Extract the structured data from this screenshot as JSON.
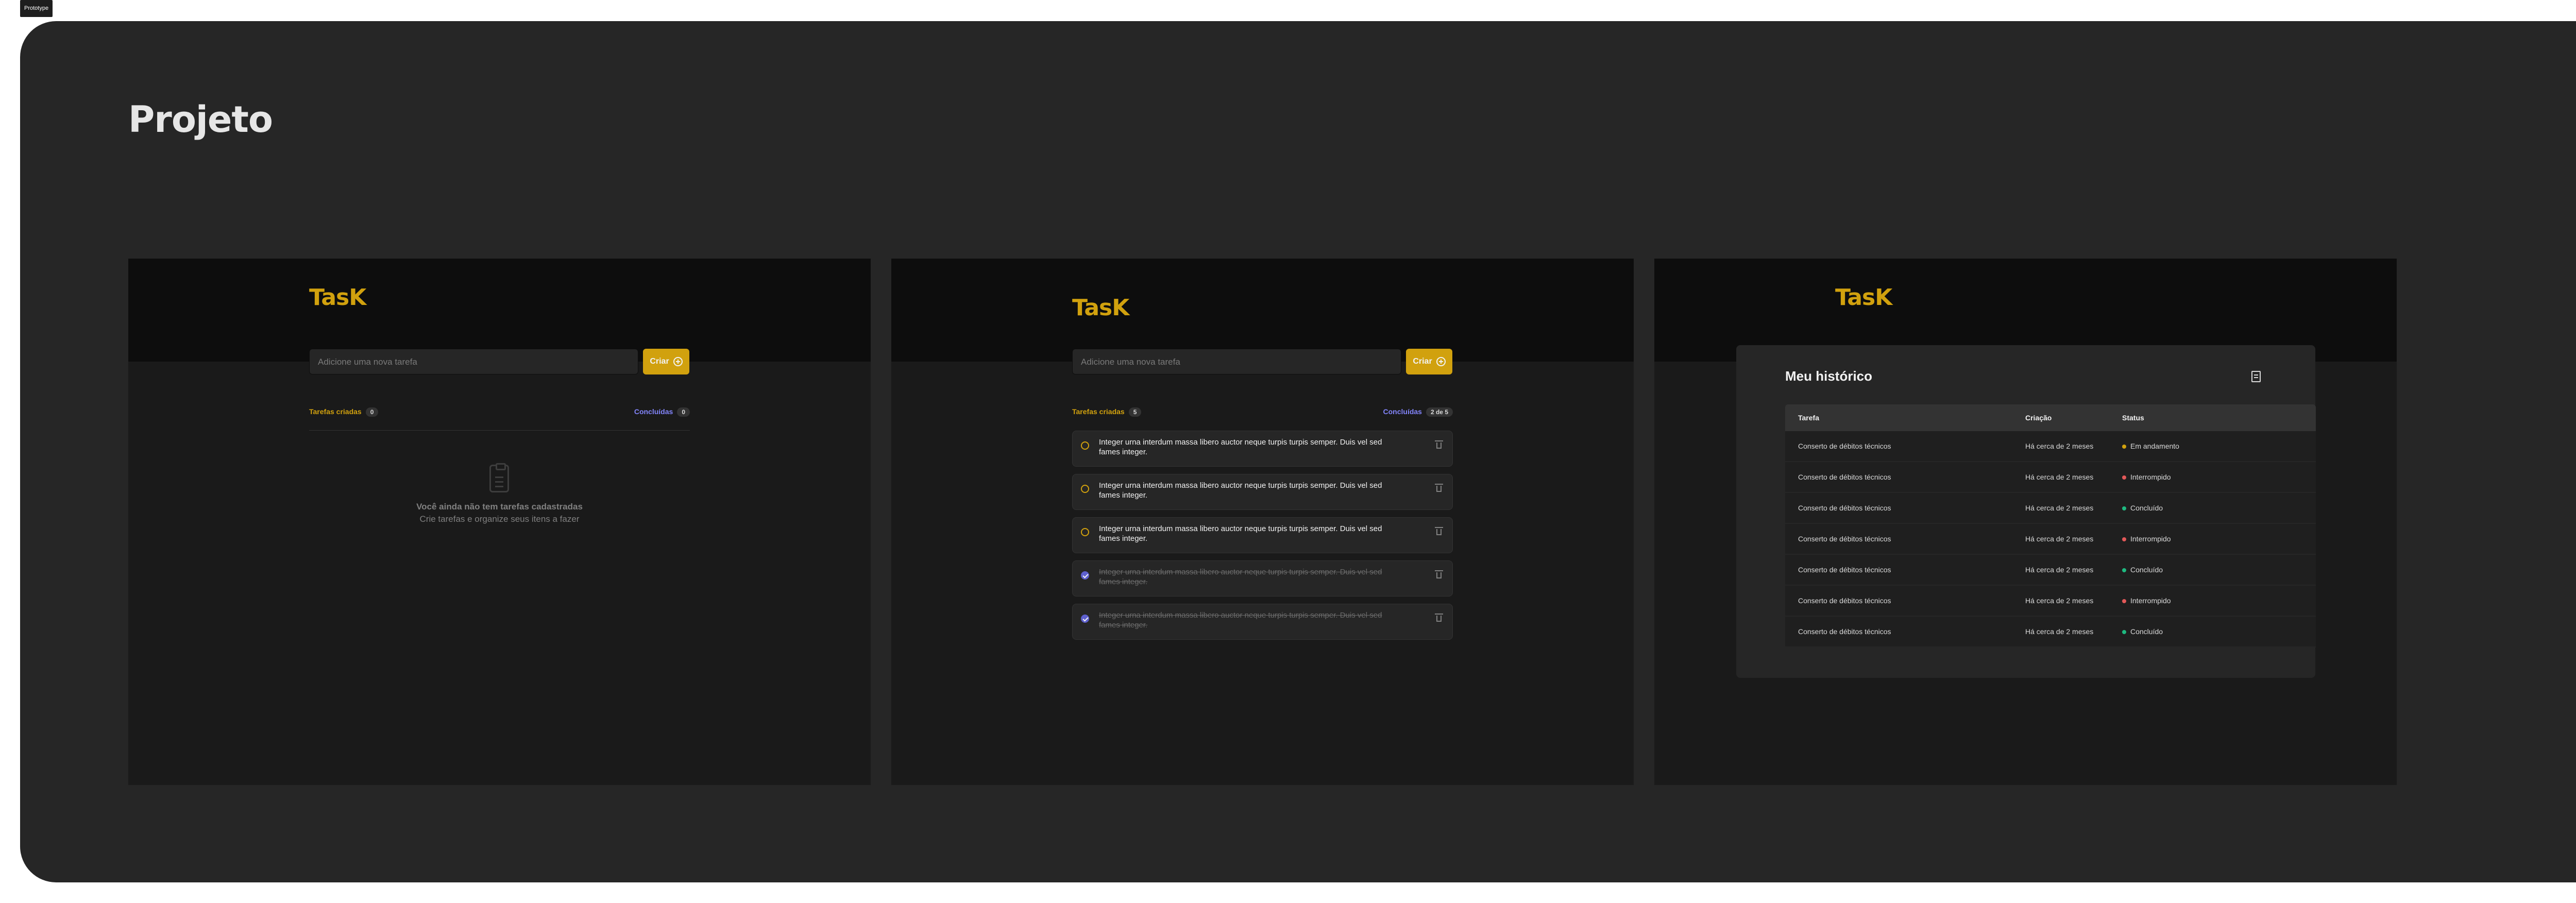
{
  "tag_label": "Prototype",
  "page_title": "Projeto",
  "colors": {
    "accent": "#d1a10e",
    "purple": "#8284fa",
    "bg": "#262626",
    "progress": "#d1a10e",
    "interrupted": "#e25858",
    "done": "#1eb980"
  },
  "screens": [
    {
      "logo": "TasK",
      "input_placeholder": "Adicione uma nova tarefa",
      "create_label": "Criar",
      "created_label": "Tarefas criadas",
      "created_count": "0",
      "done_label": "Concluídas",
      "done_count": "0",
      "empty_title": "Você ainda não tem tarefas cadastradas",
      "empty_subtitle": "Crie tarefas e organize seus itens a fazer"
    },
    {
      "logo": "TasK",
      "input_placeholder": "Adicione uma nova tarefa",
      "create_label": "Criar",
      "created_label": "Tarefas criadas",
      "created_count": "5",
      "done_label": "Concluídas",
      "done_count": "2 de 5",
      "tasks": [
        {
          "text": "Integer urna interdum massa libero auctor neque turpis turpis semper. Duis vel sed fames integer.",
          "done": false
        },
        {
          "text": "Integer urna interdum massa libero auctor neque turpis turpis semper. Duis vel sed fames integer.",
          "done": false
        },
        {
          "text": "Integer urna interdum massa libero auctor neque turpis turpis semper. Duis vel sed fames integer.",
          "done": false
        },
        {
          "text": "Integer urna interdum massa libero auctor neque turpis turpis semper. Duis vel sed fames integer.",
          "done": true
        },
        {
          "text": "Integer urna interdum massa libero auctor neque turpis turpis semper. Duis vel sed fames integer.",
          "done": true
        }
      ]
    },
    {
      "logo": "TasK",
      "history_title": "Meu histórico",
      "columns": [
        "Tarefa",
        "Criação",
        "Status"
      ],
      "rows": [
        {
          "task": "Conserto de débitos técnicos",
          "created": "Há cerca de 2 meses",
          "status": "Em andamento",
          "status_color": "#d1a10e"
        },
        {
          "task": "Conserto de débitos técnicos",
          "created": "Há cerca de 2 meses",
          "status": "Interrompido",
          "status_color": "#e25858"
        },
        {
          "task": "Conserto de débitos técnicos",
          "created": "Há cerca de 2 meses",
          "status": "Concluído",
          "status_color": "#1eb980"
        },
        {
          "task": "Conserto de débitos técnicos",
          "created": "Há cerca de 2 meses",
          "status": "Interrompido",
          "status_color": "#e25858"
        },
        {
          "task": "Conserto de débitos técnicos",
          "created": "Há cerca de 2 meses",
          "status": "Concluído",
          "status_color": "#1eb980"
        },
        {
          "task": "Conserto de débitos técnicos",
          "created": "Há cerca de 2 meses",
          "status": "Interrompido",
          "status_color": "#e25858"
        },
        {
          "task": "Conserto de débitos técnicos",
          "created": "Há cerca de 2 meses",
          "status": "Concluído",
          "status_color": "#1eb980"
        }
      ]
    }
  ]
}
